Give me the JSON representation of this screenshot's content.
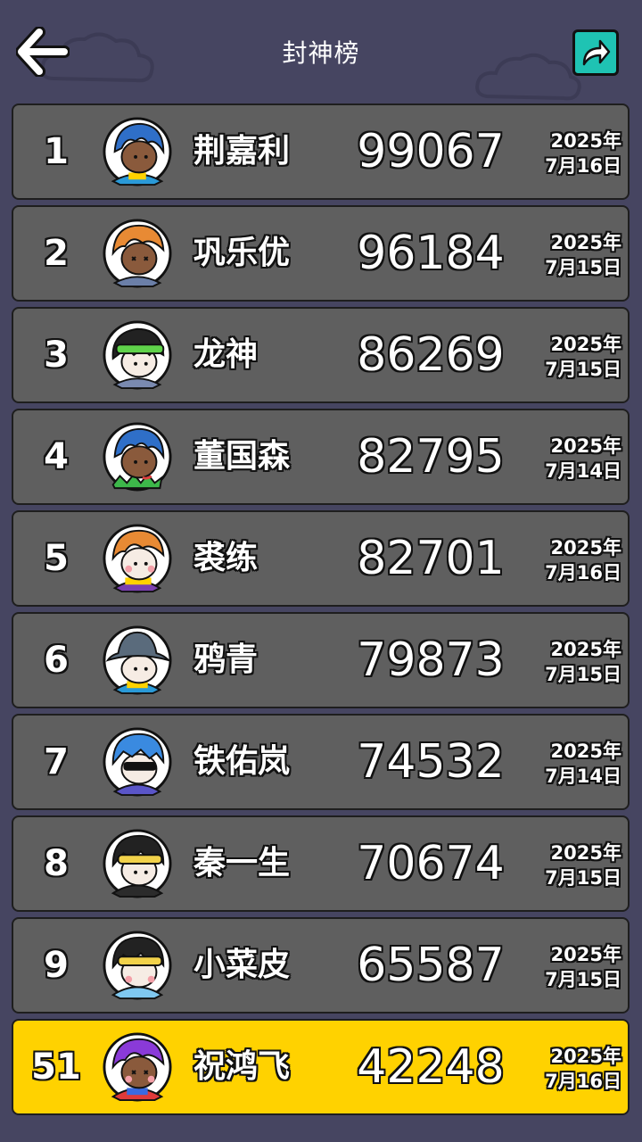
{
  "header": {
    "title": "封神榜",
    "back_icon": "arrow-left-icon",
    "share_icon": "share-arrow-icon",
    "share_color": "#1fc3b3"
  },
  "colors": {
    "background": "#464561",
    "row": "#5f5f5f",
    "self_row": "#ffd200"
  },
  "leaderboard": [
    {
      "rank": "1",
      "name": "荆嘉利",
      "score": "99067",
      "year": "2025年",
      "day": "7月16日"
    },
    {
      "rank": "2",
      "name": "巩乐优",
      "score": "96184",
      "year": "2025年",
      "day": "7月15日"
    },
    {
      "rank": "3",
      "name": "龙神",
      "score": "86269",
      "year": "2025年",
      "day": "7月15日"
    },
    {
      "rank": "4",
      "name": "董国森",
      "score": "82795",
      "year": "2025年",
      "day": "7月14日"
    },
    {
      "rank": "5",
      "name": "裘练",
      "score": "82701",
      "year": "2025年",
      "day": "7月16日"
    },
    {
      "rank": "6",
      "name": "鸦青",
      "score": "79873",
      "year": "2025年",
      "day": "7月15日"
    },
    {
      "rank": "7",
      "name": "铁佑岚",
      "score": "74532",
      "year": "2025年",
      "day": "7月14日"
    },
    {
      "rank": "8",
      "name": "秦一生",
      "score": "70674",
      "year": "2025年",
      "day": "7月15日"
    },
    {
      "rank": "9",
      "name": "小菜皮",
      "score": "65587",
      "year": "2025年",
      "day": "7月15日"
    }
  ],
  "my_entry": {
    "rank": "51",
    "name": "祝鸿飞",
    "score": "42248",
    "year": "2025年",
    "day": "7月16日"
  }
}
